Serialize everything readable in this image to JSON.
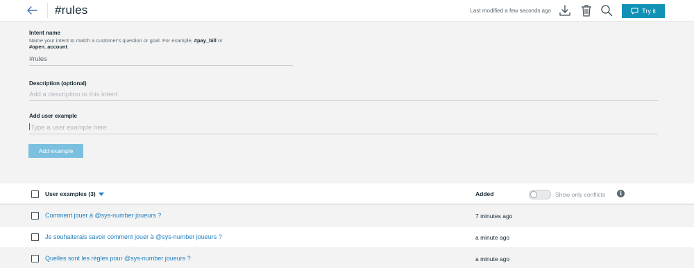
{
  "header": {
    "title": "#rules",
    "last_modified": "Last modified a few seconds ago",
    "try_label": "Try it",
    "icons": [
      "arrow-left-icon",
      "download-icon",
      "trash-icon",
      "search-icon",
      "chat-bubble-icon"
    ]
  },
  "form": {
    "intent_name_label": "Intent name",
    "intent_help_text": "Name your intent to match a customer's question or goal. For example, ",
    "intent_help_example1": "#pay_bill",
    "intent_help_or": " or",
    "intent_help_example2": "#open_account",
    "intent_help_period": ".",
    "intent_name_value": "#rules",
    "description_label": "Description (optional)",
    "description_placeholder": "Add a description to this intent",
    "user_example_label": "Add user example",
    "user_example_placeholder": "Type a user example here",
    "add_example_button": "Add example"
  },
  "table": {
    "header_examples": "User examples (3)",
    "header_added": "Added",
    "conflicts_toggle_label": "Show only conflicts",
    "conflicts_toggle_on": false,
    "info_glyph": "i",
    "rows": [
      {
        "text": "Comment jouer à @sys-number joueurs ?",
        "added": "7 minutes ago"
      },
      {
        "text": "Je souhaiterais savoir comment jouer à @sys-number joueurs ?",
        "added": "a minute ago"
      },
      {
        "text": "Quelles sont les règles pour @sys-number joueurs ?",
        "added": "a minute ago"
      }
    ]
  },
  "colors": {
    "accent": "#1192b5",
    "link": "#1f7fc0",
    "button_disabled": "#7cc0e0",
    "background": "#f3f3f3"
  }
}
